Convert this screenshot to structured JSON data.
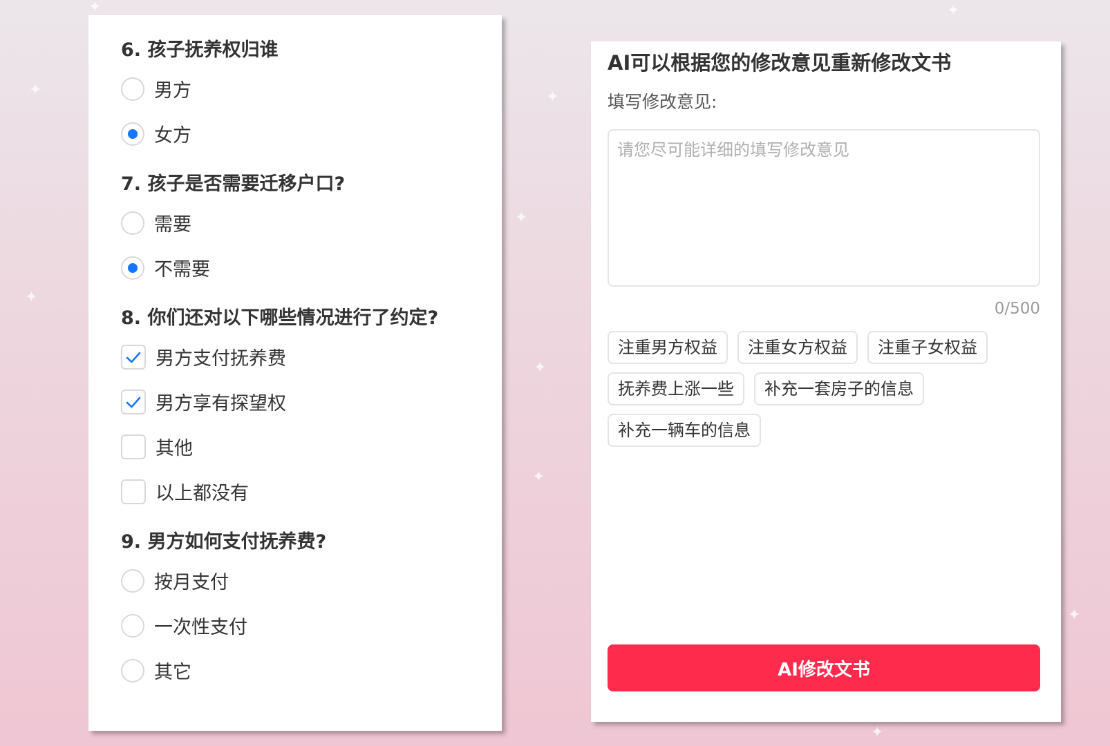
{
  "theme": {
    "accent_blue": "#1677ff",
    "button_red": "#fe2b4d",
    "border_gray": "#d9d9d9"
  },
  "questionnaire": {
    "questions": [
      {
        "title": "6. 孩子抚养权归谁",
        "type": "radio",
        "options": [
          {
            "label": "男方",
            "checked": false
          },
          {
            "label": "女方",
            "checked": true
          }
        ]
      },
      {
        "title": "7. 孩子是否需要迁移户口?",
        "type": "radio",
        "options": [
          {
            "label": "需要",
            "checked": false
          },
          {
            "label": "不需要",
            "checked": true
          }
        ]
      },
      {
        "title": "8. 你们还对以下哪些情况进行了约定?",
        "type": "checkbox",
        "options": [
          {
            "label": "男方支付抚养费",
            "checked": true
          },
          {
            "label": "男方享有探望权",
            "checked": true
          },
          {
            "label": "其他",
            "checked": false
          },
          {
            "label": "以上都没有",
            "checked": false
          }
        ]
      },
      {
        "title": "9. 男方如何支付抚养费?",
        "type": "radio",
        "options": [
          {
            "label": "按月支付",
            "checked": false
          },
          {
            "label": "一次性支付",
            "checked": false
          },
          {
            "label": "其它",
            "checked": false
          }
        ]
      }
    ]
  },
  "ai_panel": {
    "title": "AI可以根据您的修改意见重新修改文书",
    "label": "填写修改意见:",
    "textarea_placeholder": "请您尽可能详细的填写修改意见",
    "textarea_value": "",
    "counter": "0/500",
    "chips": [
      "注重男方权益",
      "注重女方权益",
      "注重子女权益",
      "抚养费上涨一些",
      "补充一套房子的信息",
      "补充一辆车的信息"
    ],
    "button_label": "AI修改文书"
  }
}
